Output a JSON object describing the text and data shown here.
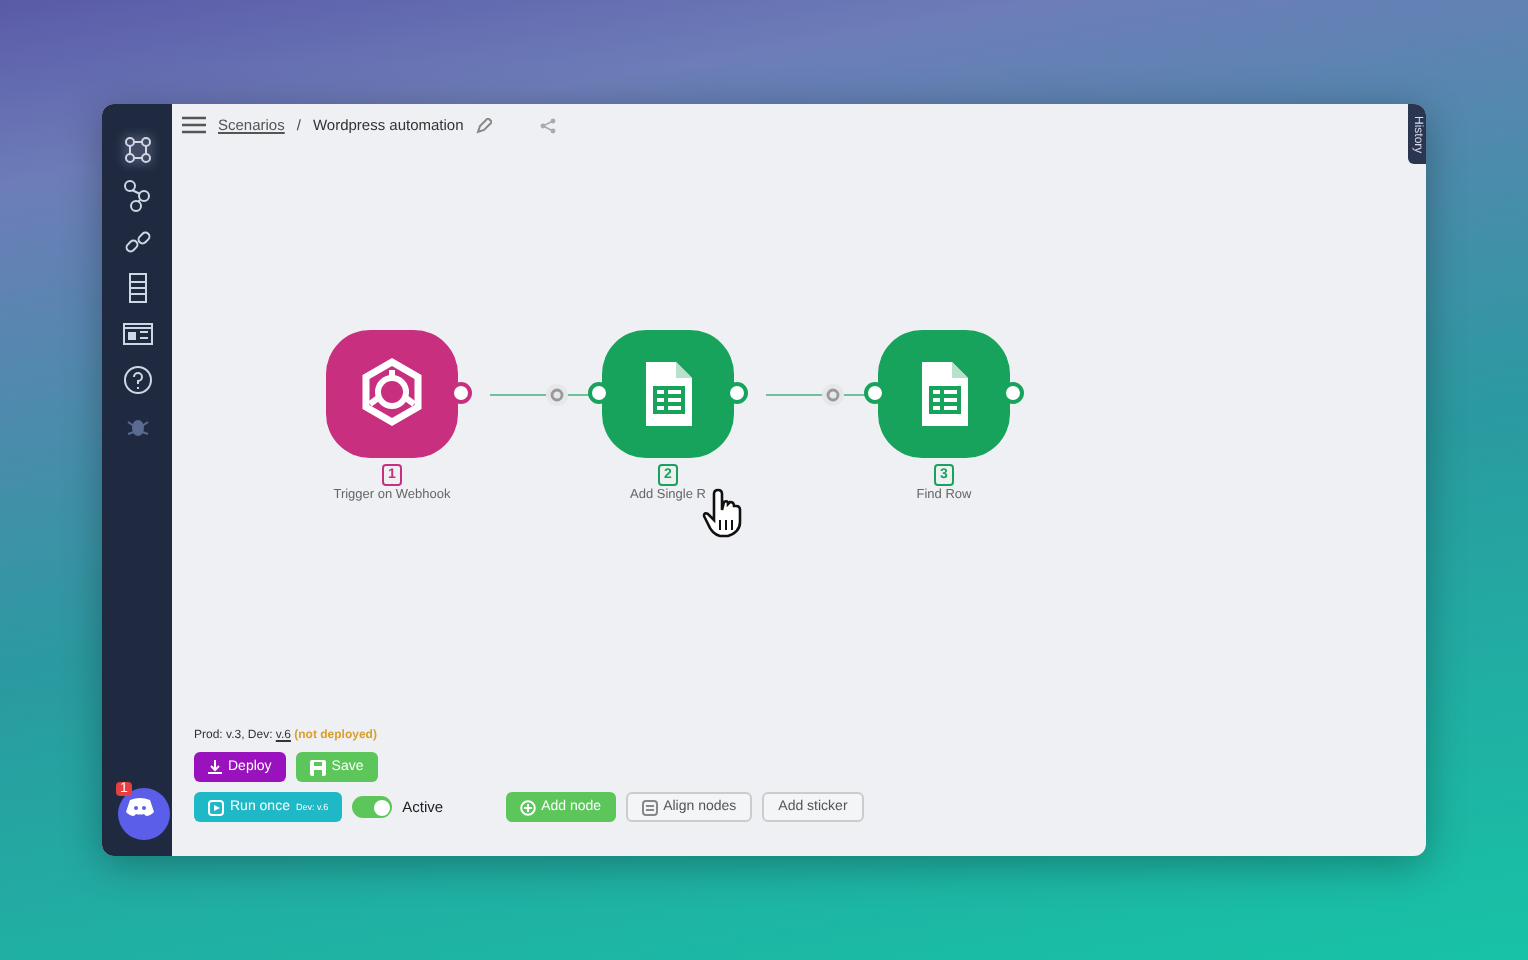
{
  "breadcrumb": {
    "parent": "Scenarios",
    "separator": "/",
    "title": "Wordpress automation"
  },
  "sidebar": {
    "items": [
      {
        "kind": "nodes",
        "selected": true
      },
      {
        "kind": "flow",
        "selected": false
      },
      {
        "kind": "link",
        "selected": false
      },
      {
        "kind": "list",
        "selected": false
      },
      {
        "kind": "card",
        "selected": false
      },
      {
        "kind": "help",
        "selected": false
      },
      {
        "kind": "bug",
        "selected": false
      }
    ],
    "chat_badge": "1"
  },
  "history_tab": "History",
  "nodes": [
    {
      "kind": "webhook",
      "number": "1",
      "label": "Trigger on Webhook",
      "color": "#c8307f"
    },
    {
      "kind": "sheet",
      "number": "2",
      "label": "Add Single R",
      "color": "#17a35b"
    },
    {
      "kind": "sheet",
      "number": "3",
      "label": "Find Row",
      "color": "#17a35b"
    }
  ],
  "version": {
    "text": "Prod: v.3, Dev: ",
    "dev": "v.6",
    "status": "(not deployed)"
  },
  "buttons": {
    "deploy": "Deploy",
    "save": "Save",
    "run_once": "Run once",
    "run_once_sup": "Dev: v.6",
    "active": {
      "label": "Active",
      "on": true
    },
    "add_node": "Add node",
    "align_nodes": "Align nodes",
    "add_sticker": "Add sticker"
  }
}
